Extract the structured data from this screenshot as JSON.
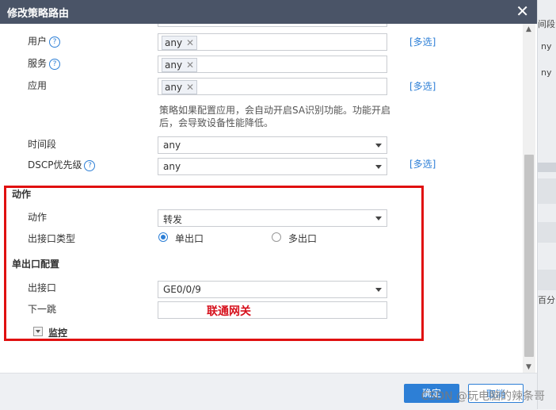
{
  "dialog": {
    "title": "修改策略路由",
    "close_glyph": "✕"
  },
  "background_panel": {
    "texts": [
      "间段",
      "ny",
      "ny",
      "百分比"
    ]
  },
  "form": {
    "user": {
      "label": "用户",
      "tag": "any",
      "multi": "[多选]"
    },
    "service": {
      "label": "服务",
      "tag": "any"
    },
    "application": {
      "label": "应用",
      "tag": "any",
      "multi": "[多选]"
    },
    "hint": "策略如果配置应用，会自动开启SA识别功能。功能开启后，会导致设备性能降低。",
    "time_range": {
      "label": "时间段",
      "value": "any"
    },
    "dscp": {
      "label": "DSCP优先级",
      "value": "any",
      "multi": "[多选]"
    }
  },
  "action_section": {
    "heading": "动作",
    "action_label": "动作",
    "action_value": "转发",
    "egress_type_label": "出接口类型",
    "radio_single": "单出口",
    "radio_multi": "多出口",
    "single_selected": true
  },
  "single_egress_section": {
    "heading": "单出口配置",
    "egress_label": "出接口",
    "egress_value": "GE0/0/9",
    "nexthop_label": "下一跳",
    "nexthop_annotation": "联通网关"
  },
  "monitor": {
    "label": "监控"
  },
  "buttons": {
    "ok": "确定",
    "cancel": "取消"
  },
  "watermark": "CSDN @玩电脑的辣条哥",
  "colors": {
    "titlebar": "#4a5467",
    "accent": "#2d7fd6",
    "highlight_box": "#e01010",
    "annotation": "#d6101c"
  }
}
